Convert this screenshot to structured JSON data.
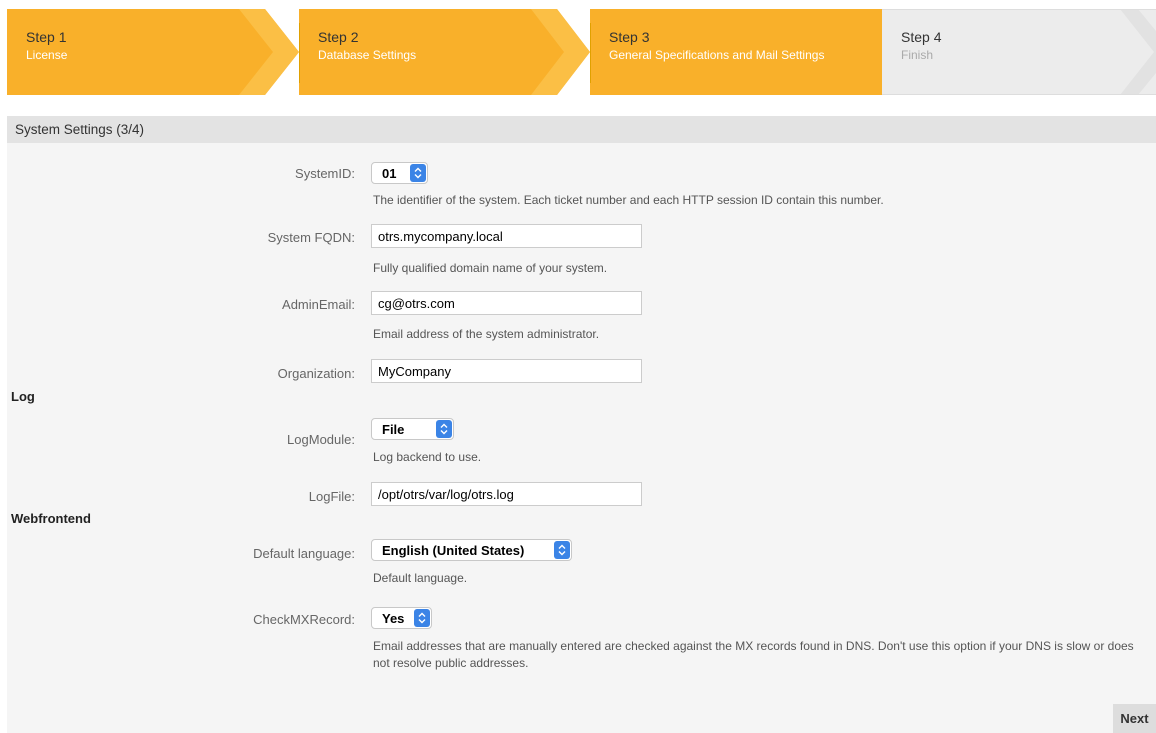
{
  "steps": [
    {
      "number": "Step 1",
      "title": "License",
      "state": "active"
    },
    {
      "number": "Step 2",
      "title": "Database Settings",
      "state": "active"
    },
    {
      "number": "Step 3",
      "title": "General Specifications and Mail Settings",
      "state": "active"
    },
    {
      "number": "Step 4",
      "title": "Finish",
      "state": "inactive"
    }
  ],
  "colors": {
    "active_step": "#f9b02a",
    "inactive_step": "#ececec",
    "select_arrow": "#3b84e6"
  },
  "panel": {
    "title": "System Settings (3/4)"
  },
  "fields": {
    "system_id": {
      "label": "SystemID:",
      "value": "01",
      "help": "The identifier of the system. Each ticket number and each HTTP session ID contain this number."
    },
    "fqdn": {
      "label": "System FQDN:",
      "value": "otrs.mycompany.local",
      "help": "Fully qualified domain name of your system."
    },
    "admin_email": {
      "label": "AdminEmail:",
      "value": "cg@otrs.com",
      "help": "Email address of the system administrator."
    },
    "organization": {
      "label": "Organization:",
      "value": "MyCompany"
    }
  },
  "log": {
    "section": "Log",
    "module": {
      "label": "LogModule:",
      "value": "File",
      "help": "Log backend to use."
    },
    "file": {
      "label": "LogFile:",
      "value": "/opt/otrs/var/log/otrs.log"
    }
  },
  "web": {
    "section": "Webfrontend",
    "language": {
      "label": "Default language:",
      "value": "English (United States)",
      "help": "Default language."
    },
    "mx": {
      "label": "CheckMXRecord:",
      "value": "Yes",
      "help": "Email addresses that are manually entered are checked against the MX records found in DNS. Don't use this option if your DNS is slow or does not resolve public addresses."
    }
  },
  "actions": {
    "next_label": "Next"
  }
}
